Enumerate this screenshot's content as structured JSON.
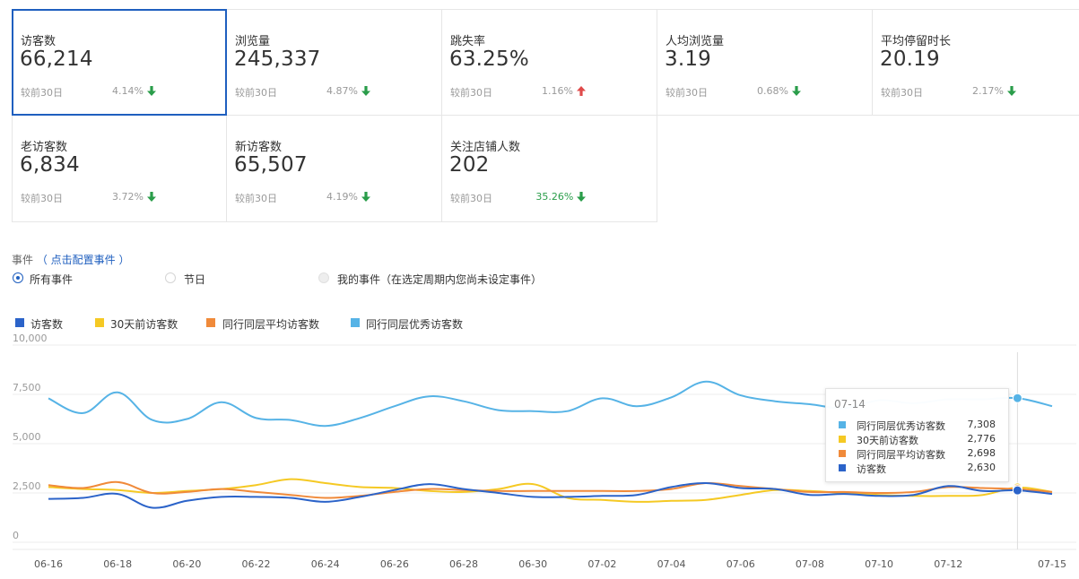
{
  "metrics": [
    {
      "label": "访客数",
      "value": "66,214",
      "compare": "较前30日",
      "pct": "4.14%",
      "trend": "down",
      "pct_color": "gray",
      "active": true
    },
    {
      "label": "浏览量",
      "value": "245,337",
      "compare": "较前30日",
      "pct": "4.87%",
      "trend": "down",
      "pct_color": "gray"
    },
    {
      "label": "跳失率",
      "value": "63.25%",
      "compare": "较前30日",
      "pct": "1.16%",
      "trend": "up",
      "pct_color": "gray"
    },
    {
      "label": "人均浏览量",
      "value": "3.19",
      "compare": "较前30日",
      "pct": "0.68%",
      "trend": "down",
      "pct_color": "gray"
    },
    {
      "label": "平均停留时长",
      "value": "20.19",
      "compare": "较前30日",
      "pct": "2.17%",
      "trend": "down",
      "pct_color": "gray"
    },
    {
      "label": "老访客数",
      "value": "6,834",
      "compare": "较前30日",
      "pct": "3.72%",
      "trend": "down",
      "pct_color": "gray"
    },
    {
      "label": "新访客数",
      "value": "65,507",
      "compare": "较前30日",
      "pct": "4.19%",
      "trend": "down",
      "pct_color": "gray"
    },
    {
      "label": "关注店铺人数",
      "value": "202",
      "compare": "较前30日",
      "pct": "35.26%",
      "trend": "down",
      "pct_color": "green"
    }
  ],
  "events": {
    "label": "事件",
    "config_link": "（ 点击配置事件 ）",
    "options": [
      {
        "label": "所有事件",
        "state": "checked"
      },
      {
        "label": "节日",
        "state": "unchecked"
      },
      {
        "label": "我的事件（在选定周期内您尚未设定事件）",
        "state": "disabled"
      }
    ]
  },
  "colors": {
    "visitors": "#2b63c9",
    "prev30": "#f5c924",
    "peer_avg": "#f08a3a",
    "peer_top": "#56b3e6",
    "up": "#e04a4a",
    "down": "#2a9d4a",
    "active_border": "#1f5fbf"
  },
  "chart_data": {
    "type": "line",
    "x": [
      "06-16",
      "06-17",
      "06-18",
      "06-19",
      "06-20",
      "06-21",
      "06-22",
      "06-23",
      "06-24",
      "06-25",
      "06-26",
      "06-27",
      "06-28",
      "06-29",
      "06-30",
      "07-01",
      "07-02",
      "07-03",
      "07-04",
      "07-05",
      "07-06",
      "07-07",
      "07-08",
      "07-09",
      "07-10",
      "07-11",
      "07-12",
      "07-13",
      "07-14",
      "07-15"
    ],
    "x_ticks": [
      "06-16",
      "06-18",
      "06-20",
      "06-22",
      "06-24",
      "06-26",
      "06-28",
      "06-30",
      "07-02",
      "07-04",
      "07-06",
      "07-08",
      "07-10",
      "07-12",
      "07-15"
    ],
    "ylim": [
      0,
      10000
    ],
    "y_ticks": [
      "0",
      "2,500",
      "5,000",
      "7,500",
      "10,000"
    ],
    "y_tick_values": [
      0,
      2500,
      5000,
      7500,
      10000
    ],
    "grid": true,
    "legend_position": "top-left",
    "series": [
      {
        "name": "访客数",
        "color_key": "visitors",
        "values": [
          2200,
          2250,
          2450,
          1750,
          2100,
          2300,
          2300,
          2250,
          2050,
          2300,
          2650,
          2950,
          2700,
          2500,
          2300,
          2300,
          2350,
          2400,
          2800,
          3000,
          2750,
          2700,
          2400,
          2450,
          2350,
          2400,
          2850,
          2600,
          2630,
          2450
        ]
      },
      {
        "name": "30天前访客数",
        "color_key": "prev30",
        "values": [
          2800,
          2700,
          2650,
          2500,
          2600,
          2700,
          2900,
          3200,
          3000,
          2800,
          2750,
          2600,
          2550,
          2700,
          2950,
          2250,
          2150,
          2050,
          2100,
          2150,
          2400,
          2650,
          2600,
          2500,
          2400,
          2350,
          2350,
          2400,
          2776,
          2550
        ]
      },
      {
        "name": "同行同层平均访客数",
        "color_key": "peer_avg",
        "values": [
          2900,
          2750,
          3050,
          2500,
          2550,
          2700,
          2550,
          2400,
          2250,
          2350,
          2550,
          2700,
          2650,
          2600,
          2600,
          2600,
          2600,
          2600,
          2700,
          3000,
          2850,
          2700,
          2550,
          2550,
          2500,
          2550,
          2800,
          2750,
          2698,
          2550
        ]
      },
      {
        "name": "同行同层优秀访客数",
        "color_key": "peer_top",
        "values": [
          7300,
          6550,
          7600,
          6200,
          6250,
          7100,
          6300,
          6200,
          5900,
          6300,
          6900,
          7400,
          7150,
          6700,
          6650,
          6650,
          7300,
          6900,
          7350,
          8150,
          7450,
          7150,
          7000,
          6800,
          7200,
          7050,
          7250,
          7250,
          7308,
          6900
        ]
      }
    ],
    "highlight_index": 28
  },
  "tooltip": {
    "date": "07-14",
    "rows": [
      {
        "name": "同行同层优秀访客数",
        "value": "7,308",
        "color_key": "peer_top"
      },
      {
        "name": "30天前访客数",
        "value": "2,776",
        "color_key": "prev30"
      },
      {
        "name": "同行同层平均访客数",
        "value": "2,698",
        "color_key": "peer_avg"
      },
      {
        "name": "访客数",
        "value": "2,630",
        "color_key": "visitors"
      }
    ]
  }
}
